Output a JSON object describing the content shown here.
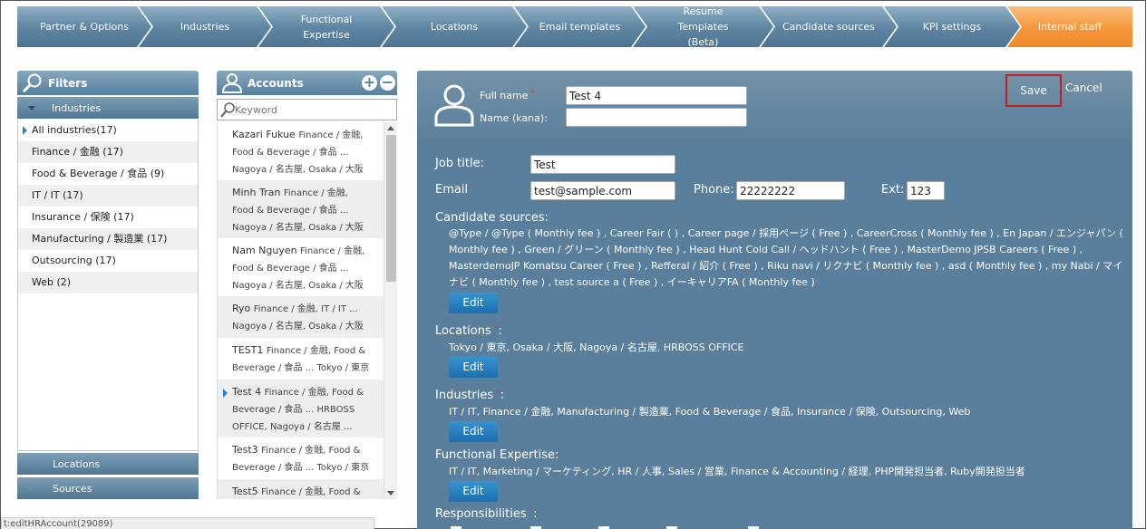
{
  "wizard": {
    "steps": [
      {
        "label": "Partner & Options"
      },
      {
        "label": "Industries"
      },
      {
        "label": "Functional Expertise"
      },
      {
        "label": "Locations"
      },
      {
        "label": "Email templates"
      },
      {
        "label": "Resume Templates (Beta)"
      },
      {
        "label": "Candidate sources"
      },
      {
        "label": "KPI settings"
      },
      {
        "label": "Internal staff"
      }
    ]
  },
  "filters": {
    "title": "Filters",
    "industries_header": "Industries",
    "items": [
      {
        "label": "All industries(17)"
      },
      {
        "label": "Finance / 金融 (17)"
      },
      {
        "label": "Food & Beverage / 食品 (9)"
      },
      {
        "label": "IT / IT (17)"
      },
      {
        "label": "Insurance / 保険 (17)"
      },
      {
        "label": "Manufacturing / 製造業 (17)"
      },
      {
        "label": "Outsourcing (17)"
      },
      {
        "label": "Web (2)"
      }
    ],
    "locations_header": "Locations",
    "sources_header": "Sources"
  },
  "accounts": {
    "title": "Accounts",
    "add_icon": "plus-circle-icon",
    "remove_icon": "minus-circle-icon",
    "search_placeholder": "Keyword",
    "items": [
      {
        "name": "Kazari Fukue",
        "detail": "Finance / 金融, Food & Beverage / 食品 ... Nagoya / 名古屋, Osaka / 大阪 ..."
      },
      {
        "name": "Minh Tran",
        "detail": "Finance / 金融, Food & Beverage / 食品 ... Nagoya / 名古屋, Osaka / 大阪 ..."
      },
      {
        "name": "Nam Nguyen",
        "detail": "Finance / 金融, Food & Beverage / 食品 ... Nagoya / 名古屋, Osaka / 大阪 ..."
      },
      {
        "name": "Ryo",
        "detail": "Finance / 金融, IT / IT ... Nagoya / 名古屋, Osaka / 大阪 ..."
      },
      {
        "name": "TEST1",
        "detail": "Finance / 金融, Food & Beverage / 食品 ... Tokyo / 東京"
      },
      {
        "name": "Test 4",
        "detail": "Finance / 金融, Food & Beverage / 食品 ... HRBOSS OFFICE, Nagoya / 名古屋 ..."
      },
      {
        "name": "Test3",
        "detail": "Finance / 金融, Food & Beverage / 食品 ... Tokyo / 東京"
      },
      {
        "name": "Test5",
        "detail": "Finance / 金融, Food & ..."
      }
    ]
  },
  "form": {
    "full_name_label": "Full name",
    "full_name_value": "Test 4",
    "name_kana_label": "Name (kana):",
    "name_kana_value": "",
    "save_label": "Save",
    "cancel_label": "Cancel",
    "job_title_label": "Job title:",
    "job_title_value": "Test",
    "email_label": "Email",
    "email_value": "test@sample.com",
    "phone_label": "Phone:",
    "phone_value": "22222222",
    "ext_label": "Ext:",
    "ext_value": "123",
    "candidate_sources_label": "Candidate sources:",
    "candidate_sources_text": "@Type / @Type ( Monthly fee ) , Career Fair ( ) , Career page / 採用ページ ( Free ) , CareerCross ( Monthly fee ) , En Japan / エンジャパン ( Monthly fee ) , Green / グリーン ( Monthly fee ) , Head Hunt Cold Call / ヘッドハント ( Free ) , MasterDemo JPSB Careers ( Free ) , MasterdemoJP Komatsu Career ( Free ) , Refferal / 紹介 ( Free ) , Riku navi / リクナビ ( Monthly fee ) , asd ( Monthly fee ) , my Nabi / マイナビ ( Monthly fee ) , test source a ( Free ) , イーキャリアFA ( Monthly fee )",
    "locations_label": "Locations",
    "locations_text": "Tokyo / 東京, Osaka / 大阪, Nagoya / 名古屋, HRBOSS OFFICE",
    "industries_label": "Industries",
    "industries_text": "IT / IT, Finance / 金融, Manufacturing / 製造業, Food & Beverage / 食品, Insurance / 保険, Outsourcing, Web",
    "functional_label": "Functional Expertise:",
    "functional_text": "IT / IT, Marketing / マーケティング, HR / 人事, Sales / 営業, Finance & Accounting / 経理, PHP開発担当者, Ruby開発担当者",
    "responsibilities_label": "Responsibilities",
    "edit_label": "Edit",
    "required_mark": "*"
  },
  "status_bar": {
    "text": "t:editHRAccount(29089)"
  }
}
